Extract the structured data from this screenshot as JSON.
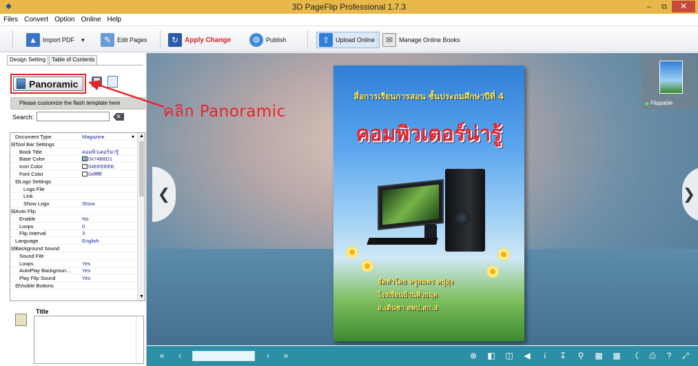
{
  "window": {
    "title": "3D PageFlip Professional 1.7.3"
  },
  "menu": [
    "Files",
    "Convert",
    "Option",
    "Online",
    "Help"
  ],
  "toolbar": {
    "import_pdf": "Import PDF",
    "edit_pages": "Edit Pages",
    "apply_change": "Apply Change",
    "publish": "Publish",
    "upload_online": "Upload Online",
    "manage_online_books": "Manage Online Books"
  },
  "left_panel": {
    "tabs": [
      "Design Setting",
      "Table of Contents"
    ],
    "template_name": "Panoramic",
    "customize_hint": "Please customize the flash template here",
    "search_label": "Search:",
    "search_value": "",
    "properties": [
      {
        "key": "Document Type",
        "value": "Magazine",
        "indent": 1
      },
      {
        "key": "⊟Tool Bar Settings",
        "value": "",
        "indent": 0
      },
      {
        "key": "Book Title",
        "value": "คอมพิวเตอร์น่ารู้",
        "indent": 2
      },
      {
        "key": "Base Color",
        "value": "0x74B8D1",
        "indent": 2,
        "swatch": "#74B8D1"
      },
      {
        "key": "Icon Color",
        "value": "0xEEEEEE",
        "indent": 2,
        "swatch": "#EEEEEE"
      },
      {
        "key": "Font Color",
        "value": "0xffffff",
        "indent": 2,
        "swatch": "#ffffff"
      },
      {
        "key": "⊟Logo Settings",
        "value": "",
        "indent": 1
      },
      {
        "key": "Logo File",
        "value": "",
        "indent": 3
      },
      {
        "key": "Link",
        "value": "",
        "indent": 3
      },
      {
        "key": "Show Logo",
        "value": "Show",
        "indent": 3
      },
      {
        "key": "⊟Auto Flip",
        "value": "",
        "indent": 0
      },
      {
        "key": "Enable",
        "value": "No",
        "indent": 2
      },
      {
        "key": "Loops",
        "value": "0",
        "indent": 2
      },
      {
        "key": "Flip Interval",
        "value": "3",
        "indent": 2
      },
      {
        "key": "Language",
        "value": "English",
        "indent": 1
      },
      {
        "key": "⊟Background Sound",
        "value": "",
        "indent": 0
      },
      {
        "key": "Sound File",
        "value": "",
        "indent": 2
      },
      {
        "key": "Loops",
        "value": "Yes",
        "indent": 2
      },
      {
        "key": "AutoPlay Backgroun...",
        "value": "Yes",
        "indent": 2
      },
      {
        "key": "Play Flip Sound",
        "value": "Yes",
        "indent": 2
      },
      {
        "key": "⊟Visible Buttons",
        "value": "",
        "indent": 1
      }
    ],
    "description_title": "Title"
  },
  "annotation": {
    "text": "คลิก Panoramic",
    "color": "#e8232b"
  },
  "book": {
    "subtitle": "สื่อการเรียนการสอน ชั้นประถมศึกษาปีที่ 4",
    "title": "คอมพิวเตอร์น่ารู้",
    "author": "จัดทำโดย ครูสมพร  หมู่สุง",
    "school": "โรงเรียนบ้านห้วยมุด",
    "district": "อ.เดินชา  สพป.สก.3"
  },
  "thumbnail": {
    "label": "Flippable"
  },
  "bottom_bar": {
    "color": "#2d8fa5"
  }
}
